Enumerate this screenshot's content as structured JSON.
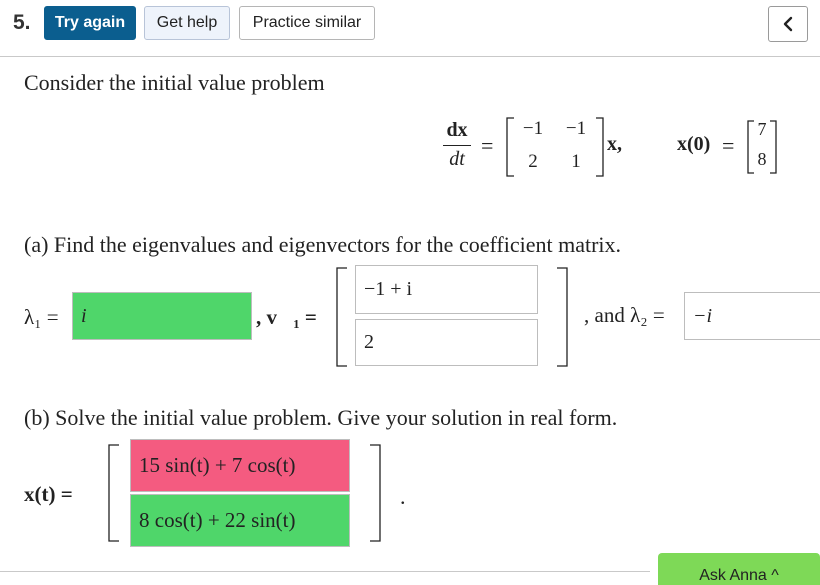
{
  "toolbar": {
    "question_number": "5.",
    "try_again": "Try again",
    "get_help": "Get help",
    "practice_similar": "Practice similar",
    "back_icon": "chevron-left-icon"
  },
  "problem": {
    "intro": "Consider the initial value problem",
    "ode_lhs_num": "dx",
    "ode_lhs_den": "dt",
    "equals": "=",
    "matrix": [
      [
        "−1",
        "−1"
      ],
      [
        "2",
        "1"
      ]
    ],
    "vector_suffix": "x,",
    "ic_label": "x(0)",
    "ic_vector": [
      "7",
      "8"
    ]
  },
  "part_a": {
    "prompt": "(a) Find the eigenvalues and eigenvectors for the coefficient matrix.",
    "lambda1_label": "λ₁ =",
    "lambda1_value": "i",
    "v1_label": ", v⃗₁ =",
    "v1_entries": [
      "−1 + i",
      "2"
    ],
    "and_lambda2_label": ", and λ₂ =",
    "lambda2_value": "−i"
  },
  "part_b": {
    "prompt": "(b) Solve the initial value problem. Give your solution in real form.",
    "xt_label": "x(t) =",
    "solution_entries": [
      "15 sin(t) + 7 cos(t)",
      "8 cos(t) + 22 sin(t)"
    ],
    "period": "."
  },
  "footer": {
    "ask_button": "Ask Anna ^"
  },
  "colors": {
    "primary": "#0b5e8f",
    "correct": "#4fd66a",
    "incorrect": "#f45b80",
    "ask": "#7ed957"
  }
}
